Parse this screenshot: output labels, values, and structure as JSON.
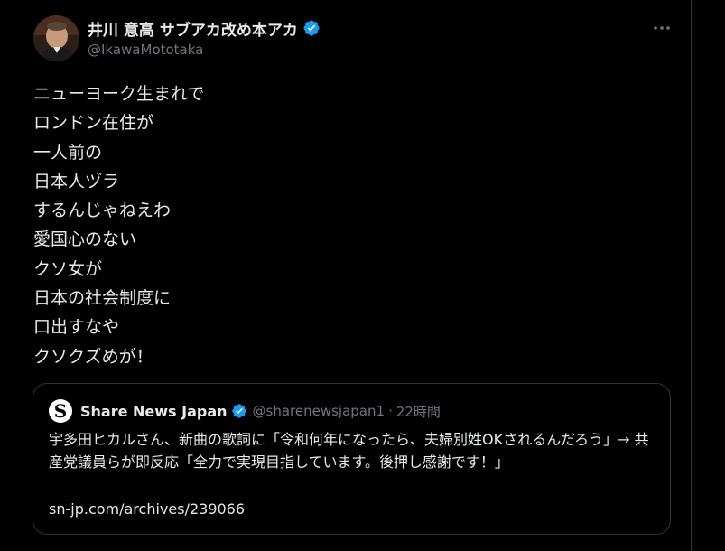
{
  "author": {
    "display_name": "井川 意高 サブアカ改め本アカ",
    "handle": "@IkawaMototaka",
    "avatar_icon": "user-avatar-icon",
    "verified_icon": "verified-badge-icon"
  },
  "menu": {
    "more_icon": "more-options-icon"
  },
  "tweet": {
    "lines": [
      "ニューヨーク生まれで",
      "ロンドン在住が",
      "一人前の",
      "日本人ヅラ",
      "するんじゃねえわ",
      "愛国心のない",
      "クソ女が",
      "日本の社会制度に",
      "口出すなや",
      "クソクズめが！"
    ]
  },
  "quote": {
    "logo_letter": "S",
    "name": "Share News Japan",
    "handle": "@sharenewsjapan1",
    "separator": "·",
    "time": "22時間",
    "text": "宇多田ヒカルさん、新曲の歌詞に「令和何年になったら、夫婦別姓OKされるんだろう」→ 共産党議員らが即反応「全力で実現目指しています。後押し感謝です！」",
    "link": "sn-jp.com/archives/239066"
  },
  "colors": {
    "background": "#000000",
    "text": "#e7e9ea",
    "muted": "#71767b",
    "border": "#2f3336",
    "verified": "#1d9bf0"
  }
}
